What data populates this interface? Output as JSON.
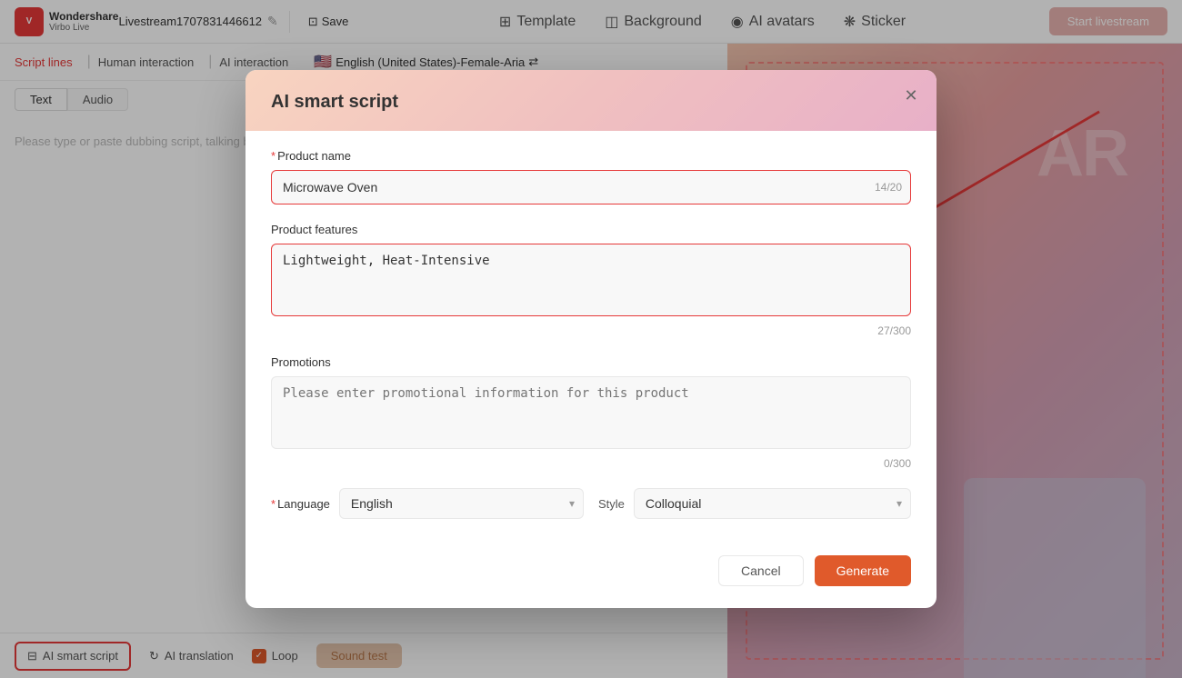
{
  "header": {
    "logo_line1": "Wondershare",
    "logo_line2": "Virbo Live",
    "filename": "Livestream1707831446612",
    "save_label": "Save",
    "template_label": "Template",
    "background_label": "Background",
    "ai_avatars_label": "AI avatars",
    "sticker_label": "Sticker",
    "start_label": "Start livestream"
  },
  "script_nav": {
    "items": [
      "Script lines",
      "Human interaction",
      "AI interaction"
    ],
    "lang": "English (United States)-Female-Aria"
  },
  "tabs": {
    "items": [
      "Text",
      "Audio"
    ],
    "active": "Text"
  },
  "script_placeholder": "Please type or paste dubbing script, talking breaks.",
  "modal": {
    "title": "AI smart script",
    "product_name_label": "Product name",
    "product_name_value": "Microwave Oven",
    "product_name_count": "14/20",
    "features_label": "Product features",
    "features_value": "Lightweight, Heat-Intensive",
    "features_count": "27/300",
    "promotions_label": "Promotions",
    "promotions_placeholder": "Please enter promotional information for this product",
    "promotions_count": "0/300",
    "language_label": "Language",
    "language_value": "English",
    "style_label": "Style",
    "style_value": "Colloquial",
    "cancel_label": "Cancel",
    "generate_label": "Generate"
  },
  "bottom_bar": {
    "ai_smart_script": "AI smart script",
    "ai_translation": "AI translation",
    "loop_label": "Loop",
    "sound_test_label": "Sound test"
  },
  "preview": {
    "bg_text": "AR"
  }
}
